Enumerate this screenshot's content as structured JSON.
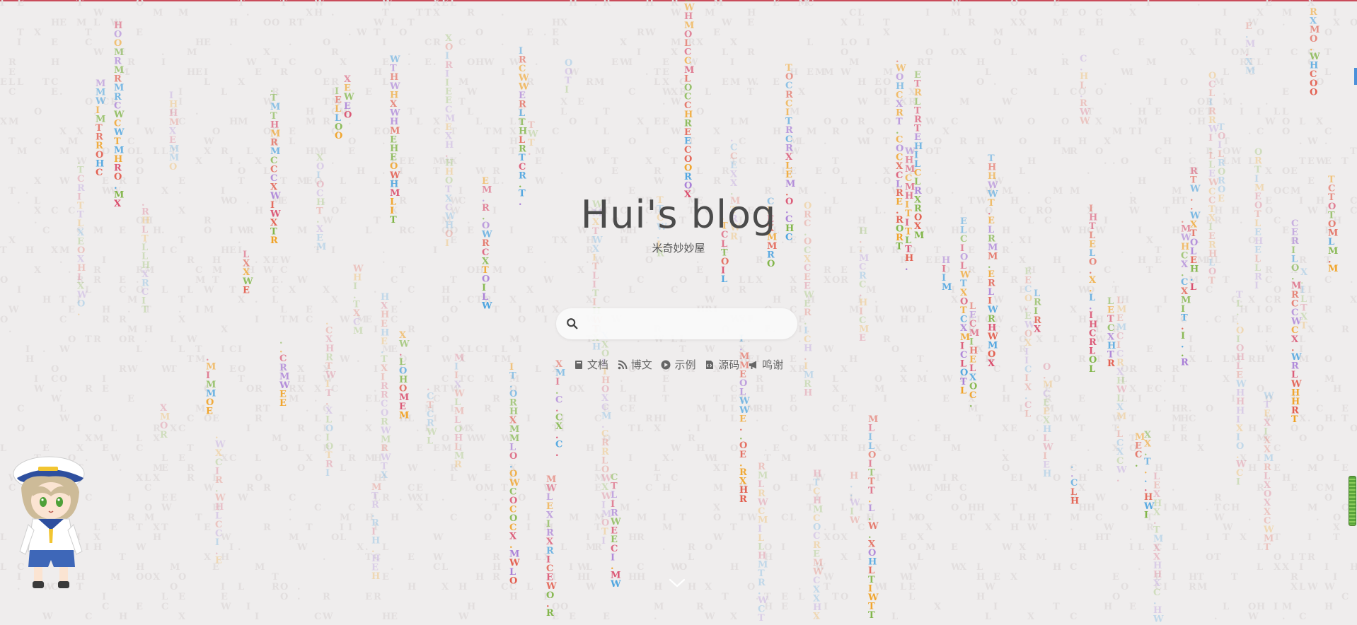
{
  "hero": {
    "title": "Hui's blog",
    "subtitle": "米奇妙妙屋"
  },
  "search": {
    "placeholder": "",
    "value": ""
  },
  "nav": [
    {
      "icon": "book-icon",
      "label": "文档"
    },
    {
      "icon": "rss-icon",
      "label": "博文"
    },
    {
      "icon": "play-icon",
      "label": "示例"
    },
    {
      "icon": "code-file-icon",
      "label": "源码"
    },
    {
      "icon": "megaphone-icon",
      "label": "鸣谢"
    }
  ],
  "colors": {
    "background": "#efeded",
    "title": "#4b4b4b",
    "matrix": [
      "#e25a4a",
      "#f0a020",
      "#7cb342",
      "#4aa3df",
      "#a77bd6",
      "#d94a6a"
    ]
  },
  "matrix_chars": "HCLWOTRMXIE."
}
